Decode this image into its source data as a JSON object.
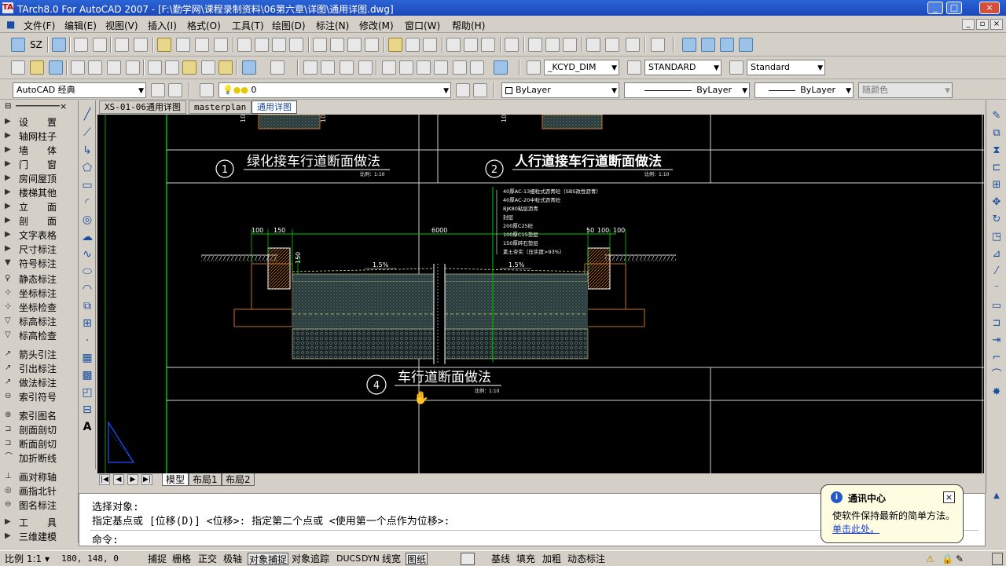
{
  "window": {
    "title": "TArch8.0 For AutoCAD 2007 - [F:\\勤学网\\课程录制资料\\06第六章\\详图\\通用详图.dwg]",
    "app_icon": "TA",
    "minimize": "_",
    "restore": "□",
    "close": "×"
  },
  "menu": [
    "文件(F)",
    "编辑(E)",
    "视图(V)",
    "插入(I)",
    "格式(O)",
    "工具(T)",
    "绘图(D)",
    "标注(N)",
    "修改(M)",
    "窗口(W)",
    "帮助(H)"
  ],
  "doc_controls": {
    "minimize": "_",
    "restore": "▫",
    "close": "×"
  },
  "toolbar1": {
    "sz_label": "SZ"
  },
  "toolbar2": {
    "dim_style": "_KCYD_DIM",
    "table_style": "STANDARD",
    "text_style": "Standard"
  },
  "toolbar3": {
    "workspace": "AutoCAD 经典",
    "layer": "0",
    "color": "ByLayer",
    "linetype": "ByLayer",
    "lineweight": "ByLayer",
    "plot_style": "随颜色"
  },
  "left_panel": {
    "items": [
      {
        "icon": "▶",
        "label": "设　　置"
      },
      {
        "icon": "▶",
        "label": "轴网柱子"
      },
      {
        "icon": "▶",
        "label": "墙　　体"
      },
      {
        "icon": "▶",
        "label": "门　　窗"
      },
      {
        "icon": "▶",
        "label": "房间屋顶"
      },
      {
        "icon": "▶",
        "label": "楼梯其他"
      },
      {
        "icon": "▶",
        "label": "立　　面"
      },
      {
        "icon": "▶",
        "label": "剖　　面"
      },
      {
        "icon": "▶",
        "label": "文字表格"
      },
      {
        "icon": "▶",
        "label": "尺寸标注"
      },
      {
        "icon": "▼",
        "label": "符号标注"
      },
      {
        "icon": "♀",
        "label": "静态标注"
      },
      {
        "icon": "⊹",
        "label": "坐标标注"
      },
      {
        "icon": "⊹",
        "label": "坐标检查"
      },
      {
        "icon": "▽",
        "label": "标高标注"
      },
      {
        "icon": "▽",
        "label": "标高检查"
      },
      {
        "icon": "↗",
        "label": "箭头引注"
      },
      {
        "icon": "↗",
        "label": "引出标注"
      },
      {
        "icon": "↗",
        "label": "做法标注"
      },
      {
        "icon": "⊖",
        "label": "索引符号"
      },
      {
        "icon": "⊕",
        "label": "索引图名"
      },
      {
        "icon": "⊐",
        "label": "剖面剖切"
      },
      {
        "icon": "⊐",
        "label": "断面剖切"
      },
      {
        "icon": "⌒",
        "label": "加折断线"
      },
      {
        "icon": "⊥",
        "label": "画对称轴"
      },
      {
        "icon": "◎",
        "label": "画指北针"
      },
      {
        "icon": "⊖",
        "label": "图名标注"
      },
      {
        "icon": "▶",
        "label": "工　　具"
      },
      {
        "icon": "▶",
        "label": "三维建模"
      }
    ]
  },
  "doc_tabs": [
    "XS-01-06通用详图",
    "masterplan",
    "通用详图"
  ],
  "layout_tabs": [
    "模型",
    "布局1",
    "布局2"
  ],
  "drawing": {
    "title1": "绿化接车行道断面做法",
    "num1": "1",
    "scale1": "比例：1:10",
    "title2": "人行道接车行道断面做法",
    "num2": "2",
    "scale2": "比例：1:10",
    "title4": "车行道断面做法",
    "num4": "4",
    "scale4": "比例：1:10",
    "dims": [
      "100",
      "150",
      "6000",
      "50",
      "100",
      "100",
      "150"
    ],
    "slope_left": "1.5%",
    "slope_right": "1.5%",
    "layers": [
      "40厚AC-13细粒式沥青砼（SBS改性沥青）",
      "40厚AC-20中粒式沥青砼",
      "BJK80粘层沥青",
      "封层",
      "200厚C25砼",
      "100厚C15垫层",
      "150厚碎石垫层",
      "素土夯实（压实度>93%）"
    ],
    "left_dims": [
      "100",
      "100"
    ]
  },
  "command": {
    "line1": "选择对象:",
    "line2": "指定基点或 [位移(D)] <位移>:  指定第二个点或 <使用第一个点作为位移>:",
    "prompt": "命令:"
  },
  "status": {
    "scale": "比例 1:1 ▾",
    "coords": "180, 148, 0",
    "toggles": [
      "捕捉",
      "栅格",
      "正交",
      "极轴",
      "对象捕捉",
      "对象追踪",
      "DUCS",
      "DYN",
      "线宽",
      "图纸"
    ],
    "right": [
      "基线",
      "填充",
      "加粗",
      "动态标注"
    ]
  },
  "balloon": {
    "title": "通讯中心",
    "body": "使软件保持最新的简单方法。",
    "link": "单击此处。",
    "close": "×",
    "info": "i"
  }
}
